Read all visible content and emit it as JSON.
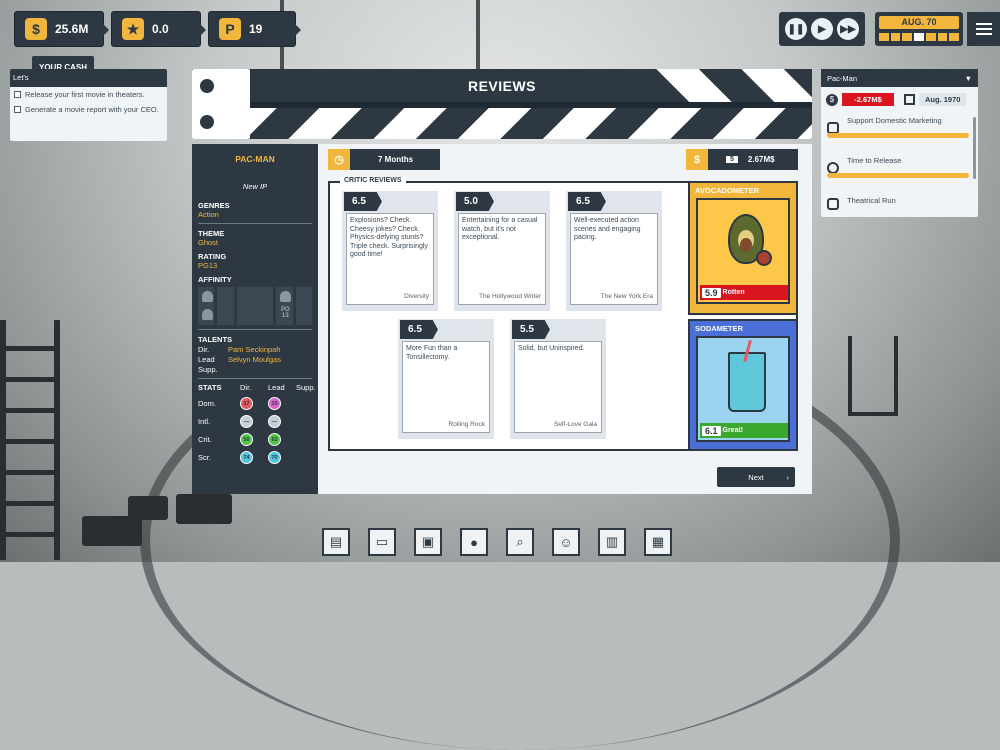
{
  "hud": {
    "cash": "25.6M",
    "stars": "0.0",
    "tickets": "19",
    "cash_tip": "YOUR CASH"
  },
  "date": "AUG. 70",
  "goals": {
    "header": "Let's",
    "items": [
      "Release your first movie in theaters.",
      "Generate a movie report with your CEO."
    ]
  },
  "right_panel": {
    "title": "Pac-Man",
    "money": "-2.67M$",
    "date": "Aug. 1970",
    "items": [
      "Support Domestic Marketing",
      "Time to Release",
      "Theatrical Run"
    ]
  },
  "window": {
    "title": "REVIEWS",
    "duration": "7 Months",
    "budget_rank": "5",
    "budget": "2.67M$",
    "critic_reviews_label": "CRITIC REVIEWS",
    "next_label": "Next"
  },
  "movie": {
    "name": "PAC-MAN",
    "ip": "New IP",
    "genres_label": "GENRES",
    "genre": "Action",
    "theme_label": "THEME",
    "theme": "Ghost",
    "rating_label": "RATING",
    "rating": "PG13",
    "affinity_label": "AFFINITY",
    "affinity_pg": "PG\n13",
    "talents_label": "TALENTS",
    "talents": [
      {
        "role": "Dir.",
        "name": "Pam Seckinpah"
      },
      {
        "role": "Lead",
        "name": "Selvyn Moulgas"
      },
      {
        "role": "Supp.",
        "name": ""
      }
    ],
    "stats_label": "STATS",
    "stats_cols": [
      "Dir.",
      "Lead",
      "Supp."
    ],
    "stats": [
      {
        "label": "Dom.",
        "dir": "17",
        "lead": "19",
        "dir_color": "#e8565f",
        "lead_color": "#d863c8"
      },
      {
        "label": "Intl.",
        "dir": "—",
        "lead": "—",
        "dir_color": "#c7ced4",
        "lead_color": "#c7ced4"
      },
      {
        "label": "Crit.",
        "dir": "50",
        "lead": "63",
        "dir_color": "#56c34a",
        "lead_color": "#56c34a"
      },
      {
        "label": "Scr.",
        "dir": "74",
        "lead": "70",
        "dir_color": "#52c6de",
        "lead_color": "#52c6de"
      }
    ]
  },
  "reviews": [
    {
      "score": "6.5",
      "text": "Explosions? Check. Cheesy jokes? Check. Physics-defying stunts? Triple check. Surprisingly good time!",
      "source": "Diversity"
    },
    {
      "score": "5.0",
      "text": "Entertaining for a casual watch, but it's not exceptional.",
      "source": "The Hollywood Writer"
    },
    {
      "score": "6.5",
      "text": "Well-executed action scenes and engaging pacing.",
      "source": "The New York Era"
    },
    {
      "score": "6.5",
      "text": "More Fun than a Tonsillectomy.",
      "source": "Rolling Rock"
    },
    {
      "score": "5.5",
      "text": "Solid, but Uninspired.",
      "source": "Self-Love Gala"
    }
  ],
  "avocadometer": {
    "title": "AVOCADOMETER",
    "score": "5.9",
    "verdict": "Rotten",
    "color": "#f2b63c",
    "badge_color": "#d9151f"
  },
  "sodameter": {
    "title": "SODAMETER",
    "score": "6.1",
    "verdict": "Great!",
    "color": "#4a6fd6",
    "badge_color": "#3aa72f"
  },
  "colors": {
    "accent": "#f2b63c",
    "dark": "#2d3843"
  }
}
